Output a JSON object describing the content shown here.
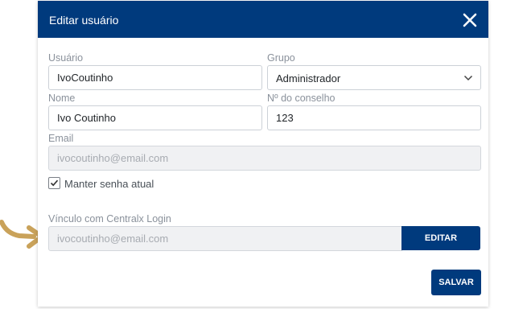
{
  "modal": {
    "title": "Editar usuário"
  },
  "form": {
    "usuario": {
      "label": "Usuário",
      "value": "IvoCoutinho"
    },
    "grupo": {
      "label": "Grupo",
      "value": "Administrador"
    },
    "nome": {
      "label": "Nome",
      "value": "Ivo Coutinho"
    },
    "conselho": {
      "label": "Nº do conselho",
      "value": "123"
    },
    "email": {
      "label": "Email",
      "placeholder": "ivocoutinho@email.com"
    },
    "manter_senha": {
      "label": "Manter senha atual",
      "checked": true
    },
    "vinculo": {
      "label": "Vínculo com Centralx Login",
      "placeholder": "ivocoutinho@email.com"
    }
  },
  "buttons": {
    "editar": "EDITAR",
    "salvar": "SALVAR"
  },
  "colors": {
    "primary": "#003a7d",
    "arrow": "#c9a25a"
  },
  "icons": {
    "close": "close-icon",
    "chevron": "chevron-down-icon",
    "check": "check-icon",
    "arrow": "curved-arrow-icon"
  }
}
